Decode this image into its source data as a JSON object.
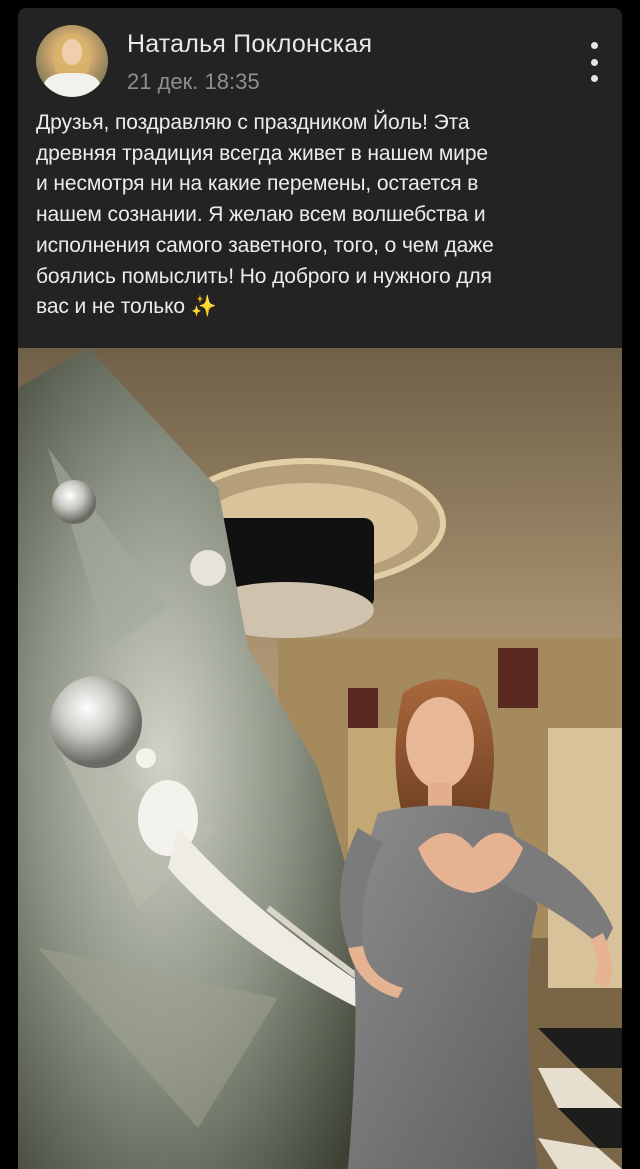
{
  "post": {
    "author": "Наталья Поклонская",
    "time": "21 дек. 18:35",
    "text": "Друзья, поздравляю с праздником Йоль! Эта\nдревняя традиция всегда живет в нашем мире\nи несмотря ни на какие перемены, остается в\nнашем сознании. Я желаю всем волшебства и\nисполнения самого заветного, того, о чем даже\nбоялись помыслить! Но доброго и нужного для\nвас и не только ✨",
    "menu_icon": "more-vertical-icon",
    "photo_icon": "post-photo"
  },
  "colors": {
    "background": "#000000",
    "card": "#232323",
    "author_text": "#e9e9e9",
    "meta_text": "#8f8f8f",
    "body_text": "#ececec"
  }
}
